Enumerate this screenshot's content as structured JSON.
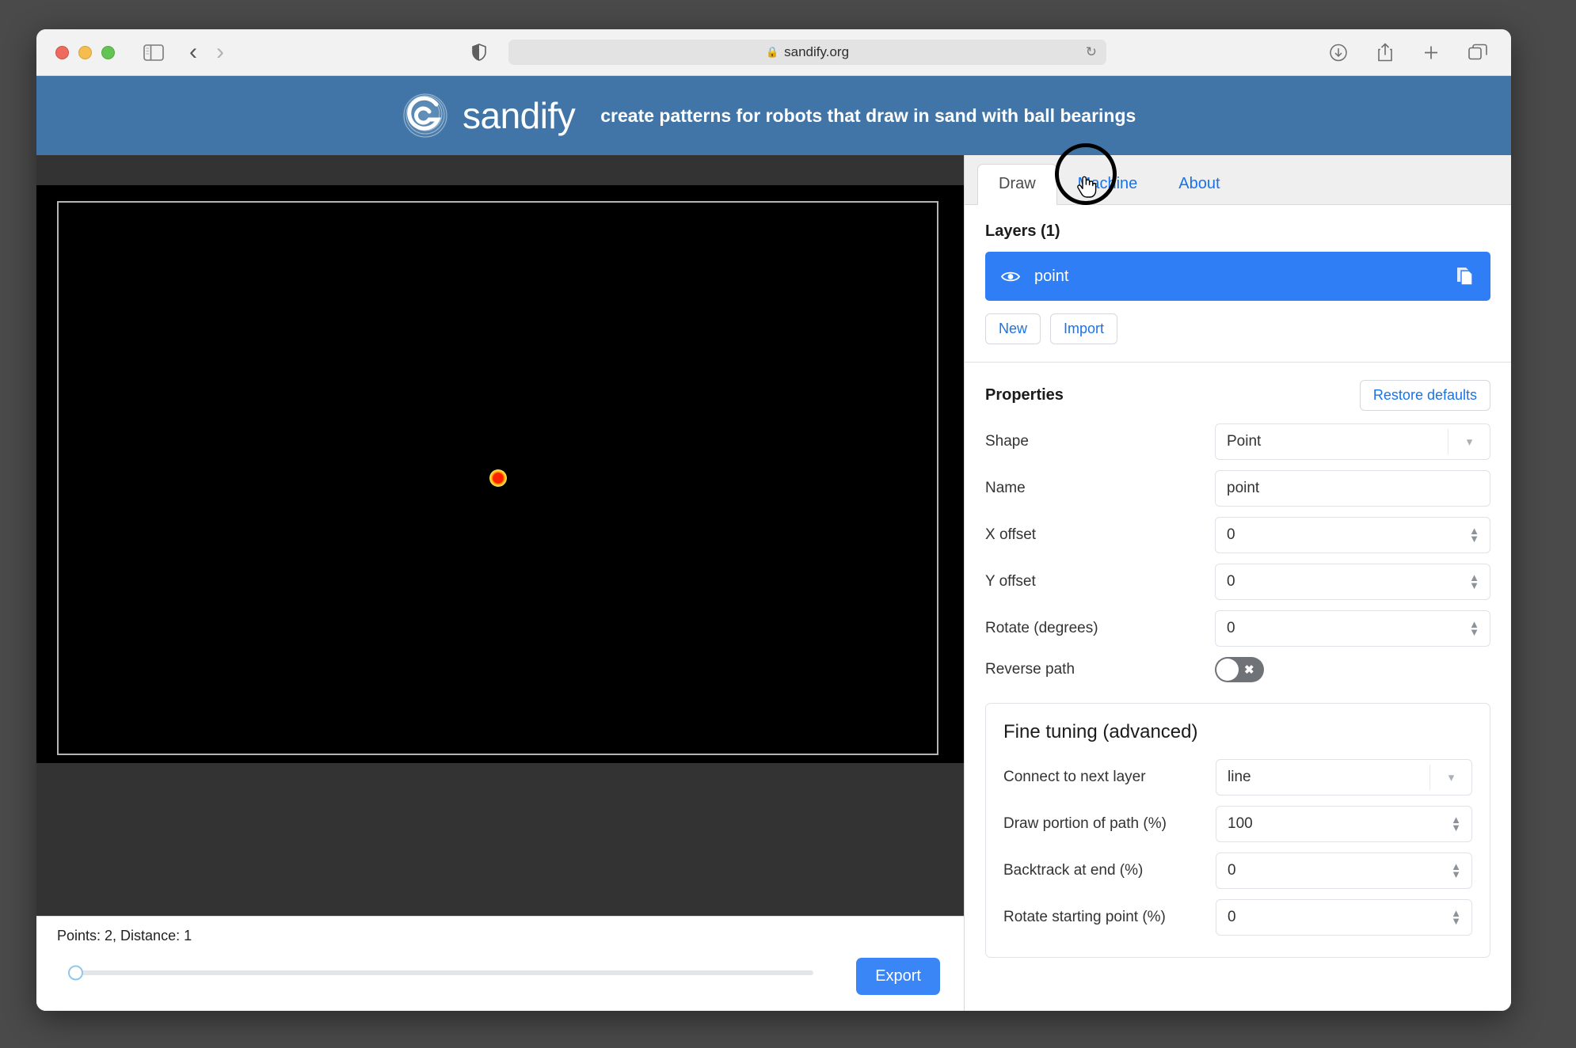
{
  "browser": {
    "traffic_lights": [
      "close",
      "minimize",
      "zoom"
    ],
    "sidebar_icon": "sidebar-icon",
    "back_icon": "chevron-left-icon",
    "forward_icon": "chevron-right-icon",
    "shield_icon": "shield-icon",
    "url": "sandify.org",
    "lock_icon": "lock-icon",
    "reload_icon": "reload-icon",
    "right_icons": [
      "download-icon",
      "share-icon",
      "new-tab-icon",
      "tab-overview-icon"
    ]
  },
  "banner": {
    "logo_icon": "sandify-spiral-logo",
    "brand": "sandify",
    "tagline": "create patterns for robots that draw in sand with ball bearings",
    "bg_color": "#4275a7"
  },
  "tabs": [
    {
      "label": "Draw",
      "active": true
    },
    {
      "label": "Machine",
      "active": false
    },
    {
      "label": "About",
      "active": false
    }
  ],
  "layers": {
    "title": "Layers (1)",
    "items": [
      {
        "name": "point",
        "visible_icon": "eye-icon",
        "copy_icon": "copy-icon",
        "selected": true
      }
    ],
    "new_label": "New",
    "import_label": "Import"
  },
  "properties": {
    "title": "Properties",
    "restore_label": "Restore defaults",
    "fields": [
      {
        "label": "Shape",
        "value": "Point",
        "type": "select"
      },
      {
        "label": "Name",
        "value": "point",
        "type": "text"
      },
      {
        "label": "X offset",
        "value": "0",
        "type": "number"
      },
      {
        "label": "Y offset",
        "value": "0",
        "type": "number"
      },
      {
        "label": "Rotate (degrees)",
        "value": "0",
        "type": "number"
      },
      {
        "label": "Reverse path",
        "value": "off",
        "type": "toggle"
      }
    ]
  },
  "fine_tuning": {
    "title": "Fine tuning (advanced)",
    "fields": [
      {
        "label": "Connect to next layer",
        "value": "line",
        "type": "select"
      },
      {
        "label": "Draw portion of path (%)",
        "value": "100",
        "type": "number"
      },
      {
        "label": "Backtrack at end (%)",
        "value": "0",
        "type": "number"
      },
      {
        "label": "Rotate starting point (%)",
        "value": "0",
        "type": "number"
      }
    ]
  },
  "canvas": {
    "background": "#000000",
    "frame_color": "#b6b6b6",
    "marker": "point-marker"
  },
  "bottom": {
    "status": "Points: 2, Distance: 1",
    "slider_value": "0",
    "export_label": "Export"
  },
  "annotation": {
    "cursor": "pointing-hand-cursor",
    "highlight": "black-circle-highlight",
    "target_tab": "Machine"
  }
}
